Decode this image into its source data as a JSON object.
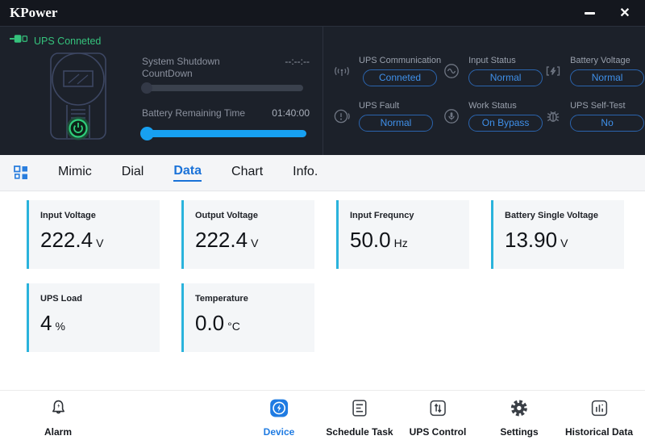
{
  "titlebar": {
    "title": "KPower",
    "close_glyph": "✕"
  },
  "header": {
    "connection": {
      "icon": "plug-connected-icon",
      "label": "UPS Conneted"
    },
    "countdown": {
      "label_line1": "System Shutdown",
      "label_line2": "CountDown",
      "value": "--:--:--",
      "progress_percent": 0
    },
    "battery": {
      "label": "Battery Remaining Time",
      "value": "01:40:00",
      "progress_percent": 100
    },
    "status_items": [
      {
        "icon": "antenna-icon",
        "label": "UPS Communication",
        "value": "Conneted"
      },
      {
        "icon": "sine-wave-icon",
        "label": "Input Status",
        "value": "Normal"
      },
      {
        "icon": "battery-charge-icon",
        "label": "Battery Voltage",
        "value": "Normal"
      },
      {
        "icon": "fault-alert-icon",
        "label": "UPS Fault",
        "value": "Normal"
      },
      {
        "icon": "work-status-icon",
        "label": "Work Status",
        "value": "On Bypass"
      },
      {
        "icon": "self-test-bug-icon",
        "label": "UPS Self-Test",
        "value": "No"
      }
    ]
  },
  "tabs": {
    "view_switcher_icon": "grid-icon",
    "items": [
      {
        "label": "Mimic",
        "active": false
      },
      {
        "label": "Dial",
        "active": false
      },
      {
        "label": "Data",
        "active": true
      },
      {
        "label": "Chart",
        "active": false
      },
      {
        "label": "Info.",
        "active": false
      }
    ]
  },
  "cards": [
    {
      "label": "Input Voltage",
      "value": "222.4",
      "unit": "V"
    },
    {
      "label": "Output Voltage",
      "value": "222.4",
      "unit": "V"
    },
    {
      "label": "Input Frequncy",
      "value": "50.0",
      "unit": "Hz"
    },
    {
      "label": "Battery Single Voltage",
      "value": "13.90",
      "unit": "V"
    },
    {
      "label": "UPS Load",
      "value": "4",
      "unit": "%"
    },
    {
      "label": "Temperature",
      "value": "0.0",
      "unit": "°C"
    }
  ],
  "bottom_nav": [
    {
      "icon": "alarm-bell-icon",
      "label": "Alarm",
      "active": false
    },
    {
      "icon": "device-icon",
      "label": "Device",
      "active": true
    },
    {
      "icon": "schedule-task-icon",
      "label": "Schedule Task",
      "active": false
    },
    {
      "icon": "ups-control-icon",
      "label": "UPS Control",
      "active": false
    },
    {
      "icon": "settings-gear-icon",
      "label": "Settings",
      "active": false
    },
    {
      "icon": "historical-data-icon",
      "label": "Historical Data",
      "active": false
    }
  ],
  "colors": {
    "dark_bg": "#1c212a",
    "titlebar_bg": "#14171e",
    "accent_green": "#35c27c",
    "accent_blue": "#3f90ea",
    "bright_blue": "#17a0f1",
    "tab_active_blue": "#1a72d8",
    "card_accent_cyan": "#2ab3dc",
    "nav_active_blue": "#1f7be2"
  }
}
